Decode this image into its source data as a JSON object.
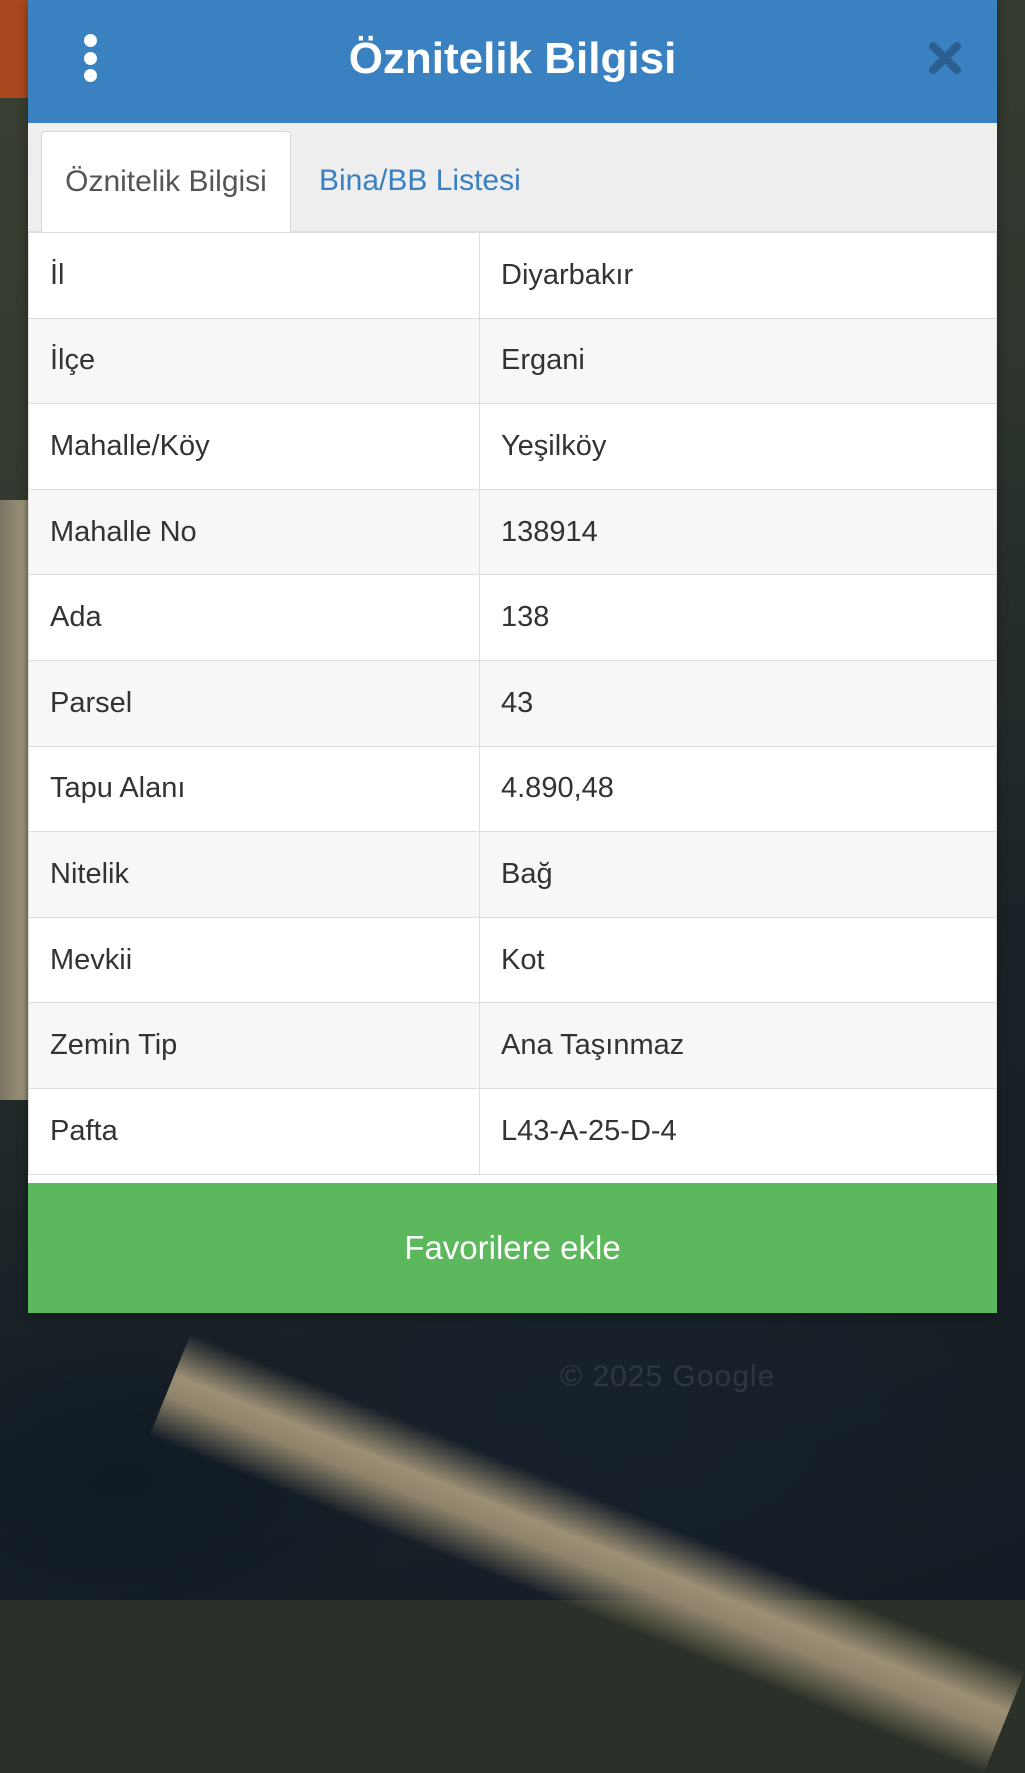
{
  "dialog": {
    "title": "Öznitelik Bilgisi",
    "menu_icon": "more-vertical-icon",
    "close_icon": "close-icon",
    "tabs": [
      {
        "label": "Öznitelik Bilgisi",
        "active": true
      },
      {
        "label": "Bina/BB Listesi",
        "active": false
      }
    ],
    "rows": [
      {
        "key": "İl",
        "value": "Diyarbakır"
      },
      {
        "key": "İlçe",
        "value": "Ergani"
      },
      {
        "key": "Mahalle/Köy",
        "value": "Yeşilköy"
      },
      {
        "key": "Mahalle No",
        "value": "138914"
      },
      {
        "key": "Ada",
        "value": "138"
      },
      {
        "key": "Parsel",
        "value": "43"
      },
      {
        "key": "Tapu Alanı",
        "value": "4.890,48"
      },
      {
        "key": "Nitelik",
        "value": "Bağ"
      },
      {
        "key": "Mevkii",
        "value": "Kot"
      },
      {
        "key": "Zemin Tip",
        "value": "Ana Taşınmaz"
      },
      {
        "key": "Pafta",
        "value": "L43-A-25-D-4"
      }
    ],
    "favorite_button": "Favorilere ekle"
  },
  "map": {
    "watermark": "© 2025 Google"
  },
  "colors": {
    "header": "#3a81c1",
    "tab_link": "#3a7fc0",
    "favorite_button": "#5cb85c"
  }
}
